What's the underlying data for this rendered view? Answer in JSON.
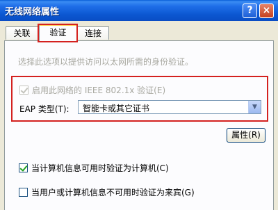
{
  "window": {
    "title": "无线网络属性",
    "help_label": "?",
    "close_label": "×"
  },
  "tabs": [
    {
      "label": "关联",
      "active": false
    },
    {
      "label": "验证",
      "active": true
    },
    {
      "label": "连接",
      "active": false
    }
  ],
  "auth": {
    "description": "选择此选项以提供访问以太网所需的身份验证。",
    "enable_8021x_label": "启用此网络的 IEEE 802.1x 验证(E)",
    "enable_8021x_checked": true,
    "enable_8021x_disabled": true,
    "eap_type_label": "EAP 类型(T):",
    "eap_type_value": "智能卡或其它证书",
    "properties_label": "属性(R)",
    "auth_as_computer_label": "当计算机信息可用时验证为计算机(C)",
    "auth_as_computer_checked": true,
    "auth_as_guest_label": "当用户或计算机信息不可用时验证为来宾(G)",
    "auth_as_guest_checked": false
  },
  "colors": {
    "highlight_border": "#d4211f",
    "titlebar": "#0b57d1",
    "dialog_bg": "#ece9d8"
  }
}
